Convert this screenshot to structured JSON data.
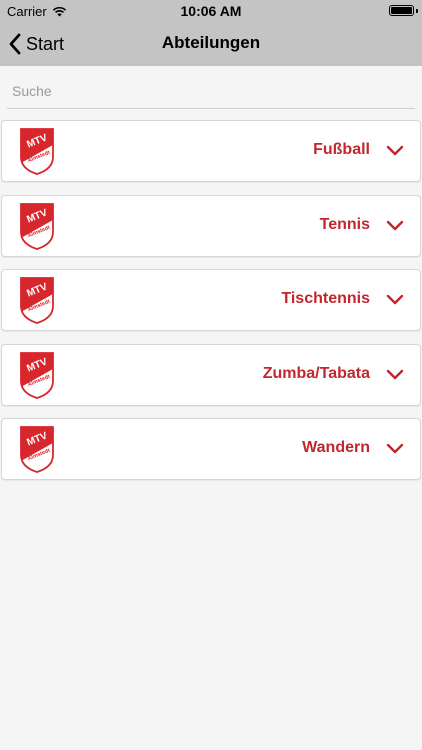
{
  "status": {
    "carrier": "Carrier",
    "time": "10:06 AM",
    "battery_level": 1.0
  },
  "nav": {
    "back_label": "Start",
    "title": "Abteilungen"
  },
  "search": {
    "placeholder": "Suche",
    "value": ""
  },
  "colors": {
    "accent": "#c1272d",
    "bar": "#c4c4c4",
    "background": "#f5f5f5"
  },
  "logo": {
    "line1": "MTV",
    "line2": "Almstedt"
  },
  "departments": [
    {
      "name": "Fußball",
      "icon": "chevron-down-icon"
    },
    {
      "name": "Tennis",
      "icon": "chevron-down-icon"
    },
    {
      "name": "Tischtennis",
      "icon": "chevron-down-icon"
    },
    {
      "name": "Zumba/Tabata",
      "icon": "chevron-down-icon"
    },
    {
      "name": "Wandern",
      "icon": "chevron-down-icon"
    }
  ]
}
